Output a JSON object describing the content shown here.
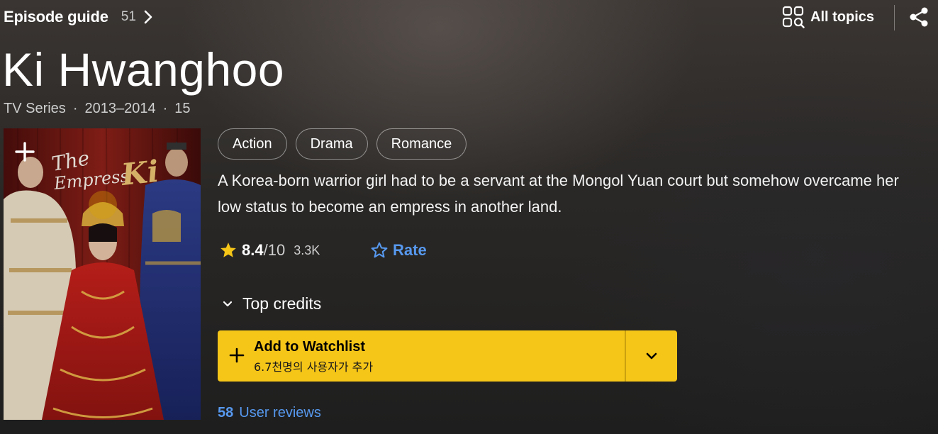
{
  "topbar": {
    "episode_guide_label": "Episode guide",
    "episode_count": "51",
    "all_topics_label": "All topics"
  },
  "title": "Ki Hwanghoo",
  "meta": {
    "type": "TV Series",
    "years": "2013–2014",
    "rating": "15",
    "separator": "·"
  },
  "poster": {
    "title_art": "The Empress Ki"
  },
  "genres": [
    "Action",
    "Drama",
    "Romance"
  ],
  "plot": "A Korea-born warrior girl had to be a servant at the Mongol Yuan court but somehow overcame her low status to become an empress in another land.",
  "rating": {
    "score": "8.4",
    "out_of": "/10",
    "votes": "3.3K",
    "rate_label": "Rate"
  },
  "credits": {
    "label": "Top credits"
  },
  "watchlist": {
    "label": "Add to Watchlist",
    "subtext": "6.7천명의 사용자가 추가"
  },
  "reviews": {
    "count": "58",
    "label": "User reviews"
  },
  "colors": {
    "accent_yellow": "#f5c518",
    "link_blue": "#5799ef",
    "star_yellow": "#f5c518"
  }
}
